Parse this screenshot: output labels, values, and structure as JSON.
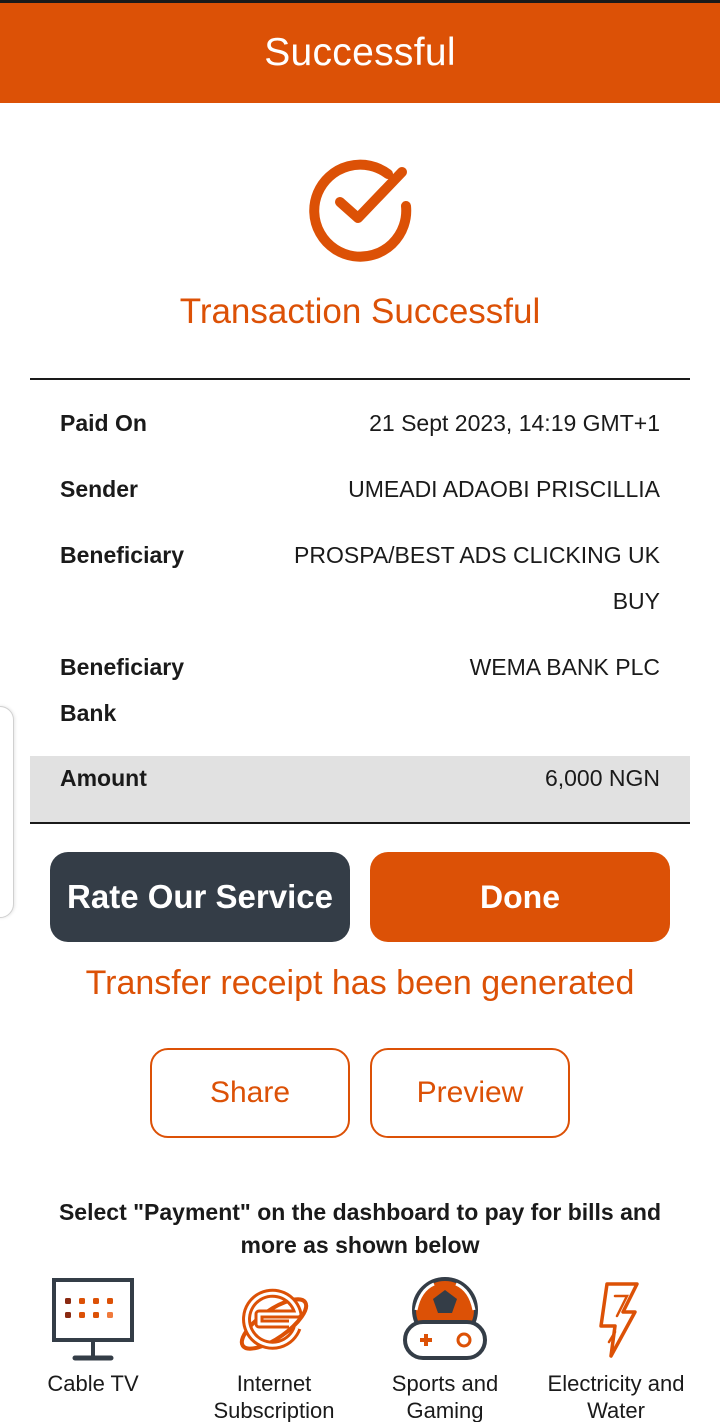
{
  "header": {
    "title": "Successful"
  },
  "status": {
    "title": "Transaction Successful",
    "icon": "check-circle-icon"
  },
  "details": {
    "paid_on": {
      "label": "Paid On",
      "value": "21 Sept 2023, 14:19 GMT+1"
    },
    "sender": {
      "label": "Sender",
      "value": "UMEADI ADAOBI PRISCILLIA"
    },
    "beneficiary": {
      "label": "Beneficiary",
      "value": "PROSPA/BEST ADS CLICKING UK BUY"
    },
    "beneficiary_bank": {
      "label": "Beneficiary Bank",
      "value": "WEMA BANK PLC"
    },
    "amount": {
      "label": "Amount",
      "value": "6,000 NGN"
    }
  },
  "actions": {
    "rate_label": "Rate Our Service",
    "done_label": "Done"
  },
  "receipt": {
    "message": "Transfer receipt has been generated",
    "share_label": "Share",
    "preview_label": "Preview"
  },
  "hint": "Select \"Payment\" on the dashboard to pay for bills and more as shown below",
  "services": [
    {
      "name": "Cable TV",
      "icon": "tv-icon"
    },
    {
      "name": "Internet Subscription",
      "icon": "internet-explorer-icon"
    },
    {
      "name": "Sports and Gaming",
      "icon": "gamepad-icon"
    },
    {
      "name": "Electricity and Water",
      "icon": "lightning-icon"
    }
  ],
  "colors": {
    "accent": "#dc5106",
    "dark_button": "#343d47",
    "amount_row_bg": "#e1e1e1"
  }
}
